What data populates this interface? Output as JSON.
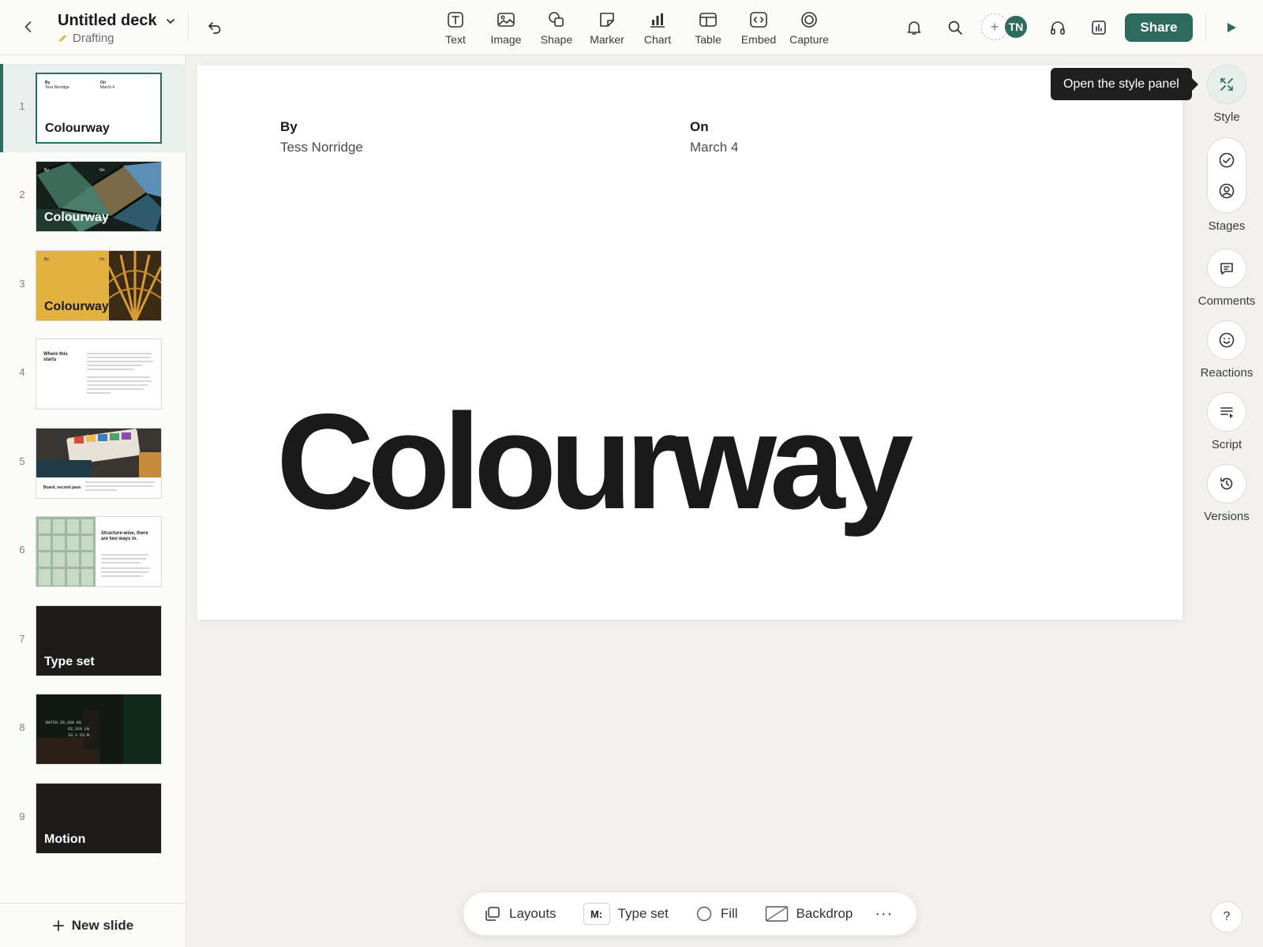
{
  "header": {
    "deck_title": "Untitled deck",
    "status": "Drafting",
    "tools": [
      {
        "label": "Text",
        "icon": "text-icon"
      },
      {
        "label": "Image",
        "icon": "image-icon"
      },
      {
        "label": "Shape",
        "icon": "shape-icon"
      },
      {
        "label": "Marker",
        "icon": "marker-icon"
      },
      {
        "label": "Chart",
        "icon": "chart-icon"
      },
      {
        "label": "Table",
        "icon": "table-icon"
      },
      {
        "label": "Embed",
        "icon": "embed-icon"
      },
      {
        "label": "Capture",
        "icon": "capture-icon"
      }
    ],
    "avatar_initials": "TN",
    "share_label": "Share",
    "accent": "#2c6b5d"
  },
  "sidebar": {
    "slides": [
      {
        "num": "1",
        "label": "Colourway",
        "by": "By",
        "by_value": "Tess Norridge",
        "on": "On",
        "on_value": "March 4"
      },
      {
        "num": "2",
        "label": "Colourway",
        "by": "By",
        "on": "On"
      },
      {
        "num": "3",
        "label": "Colourway",
        "by": "By",
        "on": "On"
      },
      {
        "num": "4",
        "heading": "Where this starts"
      },
      {
        "num": "5",
        "caption": "Board, second pass"
      },
      {
        "num": "6",
        "heading": "Structure-wise, there are two ways in."
      },
      {
        "num": "7",
        "label": "Type set"
      },
      {
        "num": "8",
        "lines": [
          "BATCH  28,260 KG",
          "62,310 LB",
          "33.2 CU.M."
        ]
      },
      {
        "num": "9",
        "label": "Motion"
      }
    ],
    "new_slide_label": "New slide"
  },
  "slide": {
    "by_label": "By",
    "by_value": "Tess Norridge",
    "on_label": "On",
    "on_value": "March 4",
    "title": "Colourway"
  },
  "tooltip": "Open the style panel",
  "rail": {
    "style": "Style",
    "stages": "Stages",
    "comments": "Comments",
    "reactions": "Reactions",
    "script": "Script",
    "versions": "Versions",
    "help": "?"
  },
  "bottombar": {
    "layouts": "Layouts",
    "typeset_badge": "M:",
    "typeset": "Type set",
    "fill": "Fill",
    "backdrop": "Backdrop",
    "more": "···"
  }
}
